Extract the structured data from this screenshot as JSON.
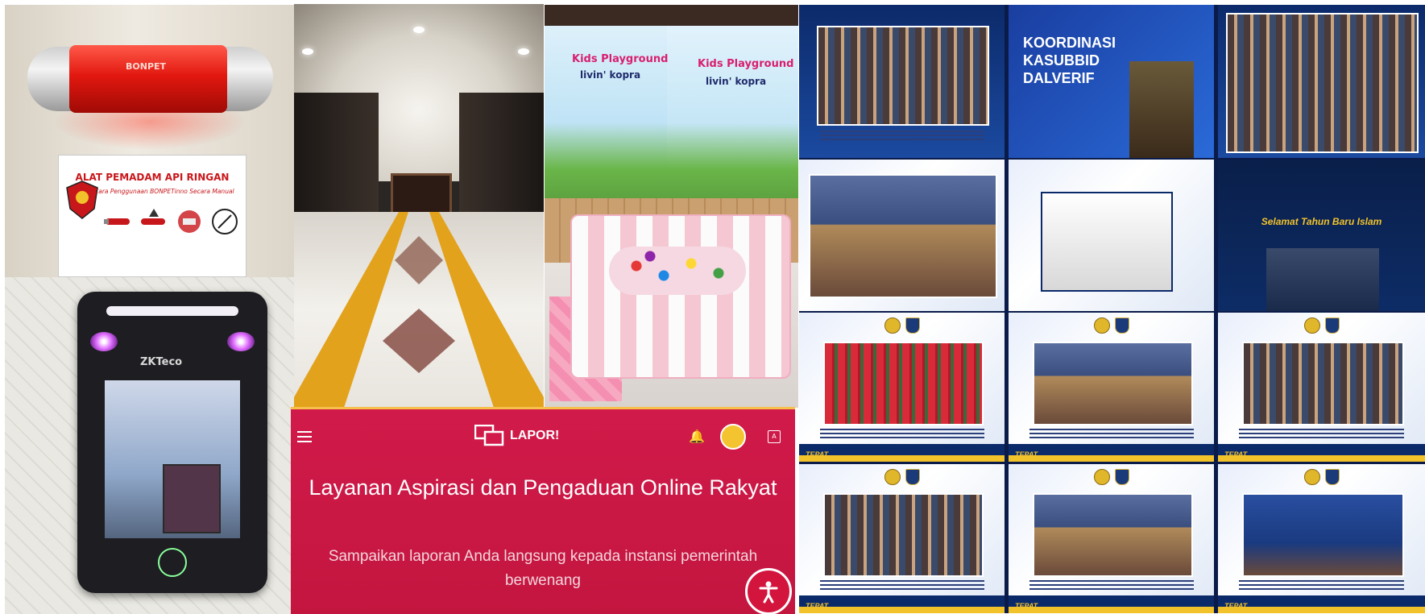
{
  "collage": {
    "extinguisher": {
      "device_brand": "BONPET",
      "sign_title": "ALAT PEMADAM API RINGAN",
      "sign_subtitle": "Cara Penggunaan BONPETinno Secara Manual"
    },
    "face_terminal": {
      "brand": "ZKTeco"
    },
    "playground": {
      "left_title": "Kids Playground",
      "left_brand": "livin' kopra",
      "right_title": "Kids Playground",
      "right_brand": "livin' kopra"
    },
    "lapor": {
      "logo_text": "LAPOR!",
      "title": "Layanan Aspirasi dan Pengaduan Online Rakyat",
      "subtitle": "Sampaikan laporan Anda langsung kepada instansi pemerintah berwenang",
      "icons": [
        "menu-icon",
        "bell-icon",
        "avatar",
        "translate-icon",
        "accessibility-icon"
      ],
      "accent_color": "#d11a4a"
    },
    "social_grid": {
      "tiles": [
        {
          "title": ""
        },
        {
          "title": "KOORDINASI KASUBBID DALVERIF"
        },
        {
          "title": ""
        },
        {
          "title": ""
        },
        {
          "title": ""
        },
        {
          "title": "Selamat Tahun Baru Islam"
        },
        {
          "footer": "TEPAT"
        },
        {
          "footer": "TEPAT"
        },
        {
          "footer": "TEPAT"
        },
        {
          "footer": "TEPAT"
        },
        {
          "footer": "TEPAT"
        },
        {
          "footer": "TEPAT"
        }
      ]
    }
  }
}
